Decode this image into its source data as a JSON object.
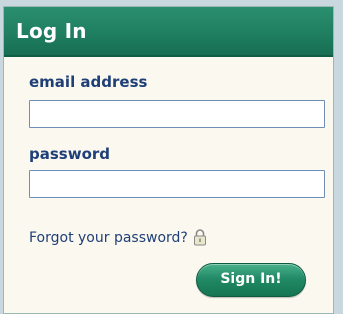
{
  "login": {
    "title": "Log In",
    "email_label": "email address",
    "email_value": "",
    "password_label": "password",
    "password_value": "",
    "forgot_text": "Forgot your password?",
    "forgot_icon": "lock-icon",
    "signin_label": "Sign In!"
  },
  "colors": {
    "header": "#1f7f60",
    "label_text": "#1f3f77",
    "panel_bg": "#fbf8ef",
    "page_bg": "#c9d8df",
    "button": "#228a66"
  }
}
